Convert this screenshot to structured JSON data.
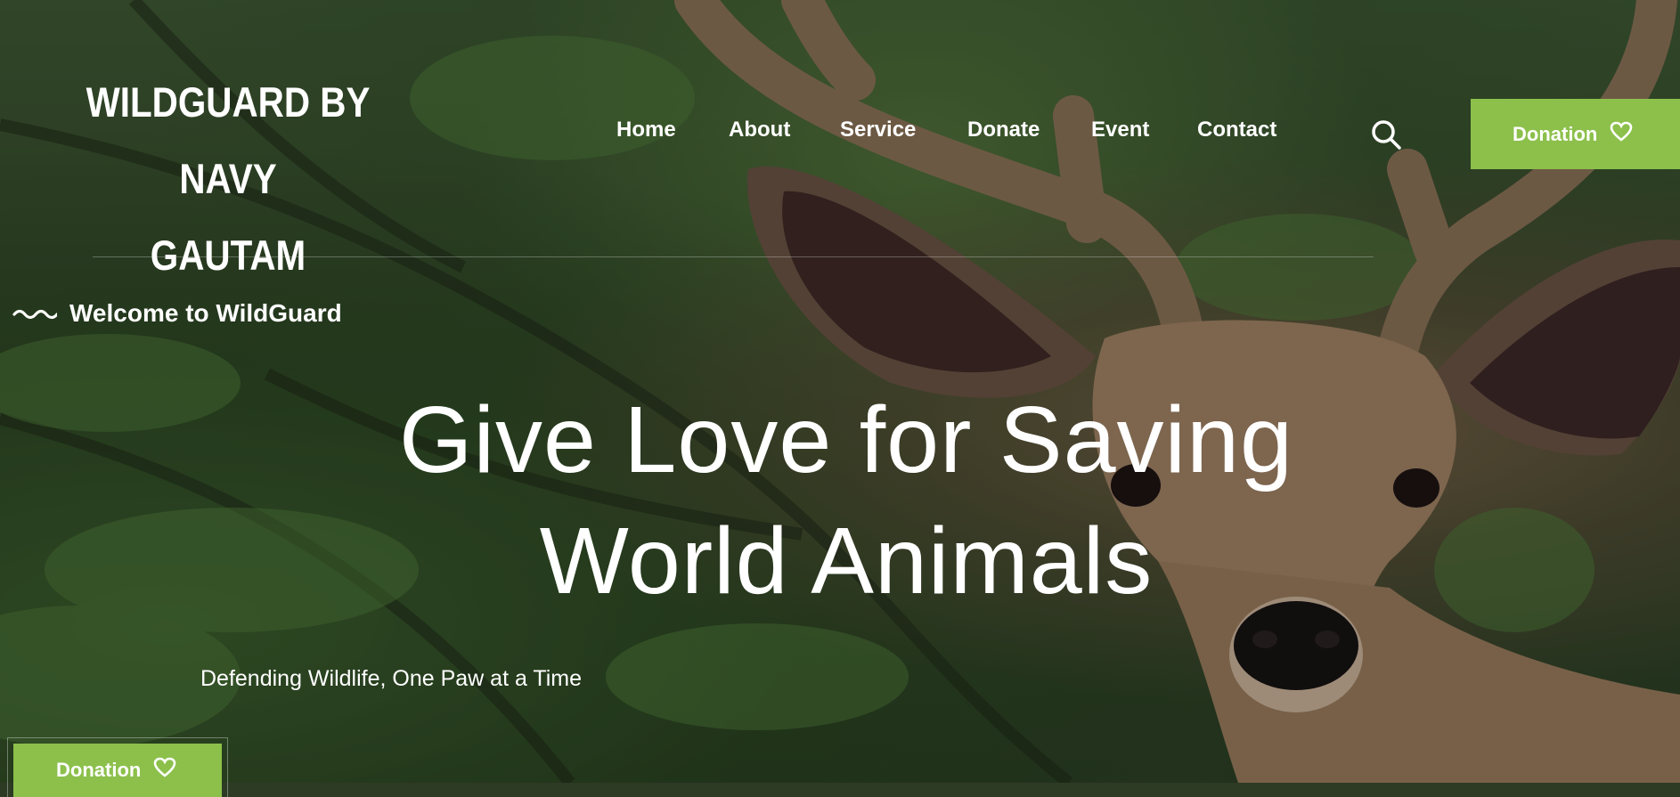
{
  "header": {
    "logo_line1": "WILDGUARD BY NAVY",
    "logo_line2": "GAUTAM",
    "nav": [
      {
        "label": "Home"
      },
      {
        "label": "About"
      },
      {
        "label": "Service"
      },
      {
        "label": "Donate"
      },
      {
        "label": "Event"
      },
      {
        "label": "Contact"
      }
    ],
    "search_icon": "search-icon",
    "donation_label": "Donation",
    "donation_icon": "heart-icon"
  },
  "hero": {
    "eyebrow": "Welcome to WildGuard",
    "eyebrow_icon": "wave-icon",
    "headline_line1": "Give Love for Saving",
    "headline_line2": "World Animals",
    "tagline": "Defending Wildlife, One Paw at a Time",
    "donation_label": "Donation",
    "donation_icon": "heart-icon"
  },
  "colors": {
    "accent": "#8cc04b",
    "text": "#ffffff"
  }
}
